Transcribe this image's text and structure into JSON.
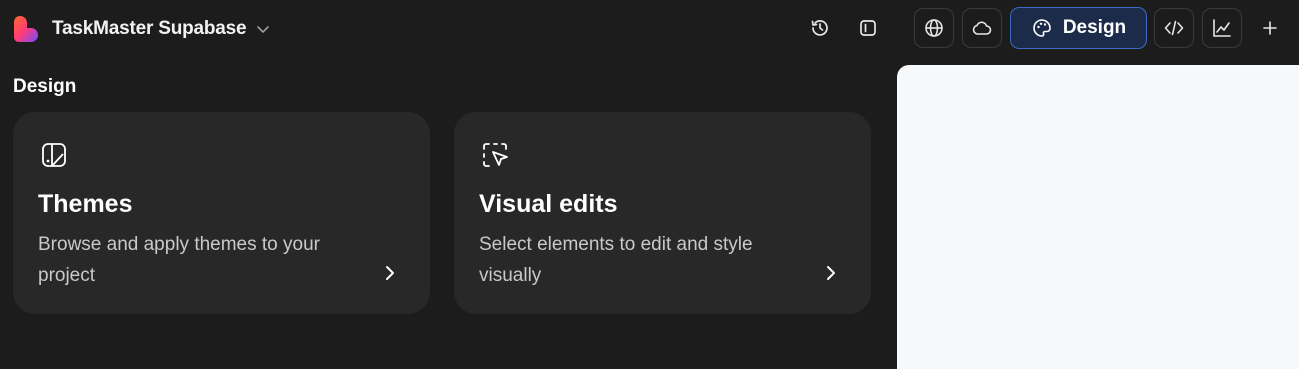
{
  "header": {
    "project_name": "TaskMaster Supabase",
    "design_button_label": "Design",
    "icons": {
      "logo": "brand-heart-logo",
      "project_menu": "chevron-down-icon",
      "history": "history-icon",
      "sidebar_toggle": "sidebar-icon",
      "publish": "globe-icon",
      "cloud": "cloud-icon",
      "design": "palette-icon",
      "code": "code-icon",
      "analytics": "chart-line-icon",
      "add": "plus-icon"
    }
  },
  "design_panel": {
    "title": "Design",
    "cards": [
      {
        "title": "Themes",
        "description": "Browse and apply themes to your project",
        "icon": "theme-palette-icon"
      },
      {
        "title": "Visual edits",
        "description": "Select elements to edit and style visually",
        "icon": "cursor-select-icon"
      }
    ]
  },
  "colors": {
    "background": "#1c1c1c",
    "card": "#282828",
    "accent_border": "#3d6ac4",
    "accent_fill": "#1c2b4a",
    "preview": "#f7f8fa"
  }
}
